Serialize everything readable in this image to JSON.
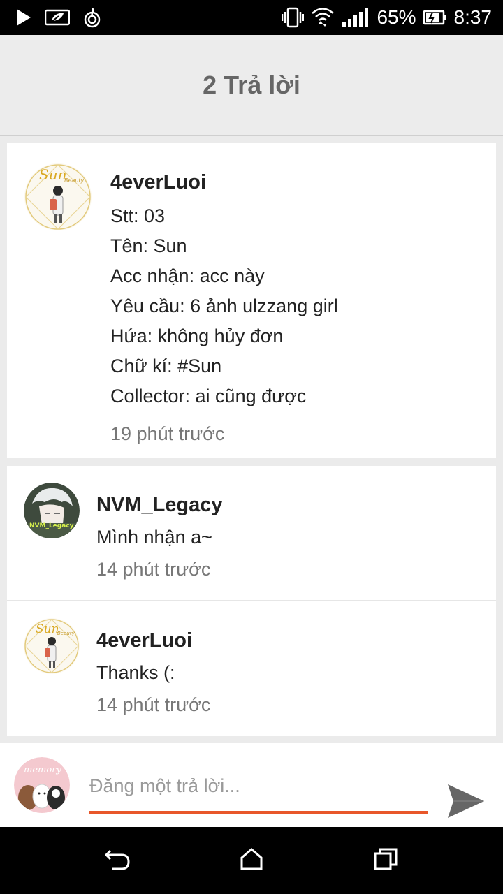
{
  "status_bar": {
    "battery_percent": "65%",
    "time": "8:37",
    "icons": [
      "play-icon",
      "leaf-icon",
      "fire-icon",
      "vibrate-icon",
      "wifi-icon",
      "signal-icon",
      "battery-icon"
    ]
  },
  "header": {
    "title": "2 Trả lời"
  },
  "post": {
    "author": "4everLuoi",
    "lines": [
      "Stt: 03",
      "Tên: Sun",
      "Acc nhận: acc này",
      "Yêu cầu: 6 ảnh ulzzang girl",
      "Hứa: không hủy đơn",
      "Chữ kí: #Sun",
      "Collector: ai cũng được"
    ],
    "time": "19 phút trước",
    "avatar_text": "Sun",
    "avatar_subtext": "Beauty"
  },
  "replies": [
    {
      "author": "NVM_Legacy",
      "text": "Mình nhận a~",
      "time": "14 phút trước",
      "avatar_text": "NVM_Legacy"
    },
    {
      "author": "4everLuoi",
      "text": "Thanks (:",
      "time": "14 phút trước",
      "avatar_text": "Sun",
      "avatar_subtext": "Beauty"
    }
  ],
  "compose": {
    "placeholder": "Đăng một trả lời...",
    "avatar_text": "memory"
  },
  "colors": {
    "accent": "#e8572a",
    "header_bg": "#ececec",
    "card_bg": "#ffffff",
    "page_bg": "#ebebeb"
  }
}
